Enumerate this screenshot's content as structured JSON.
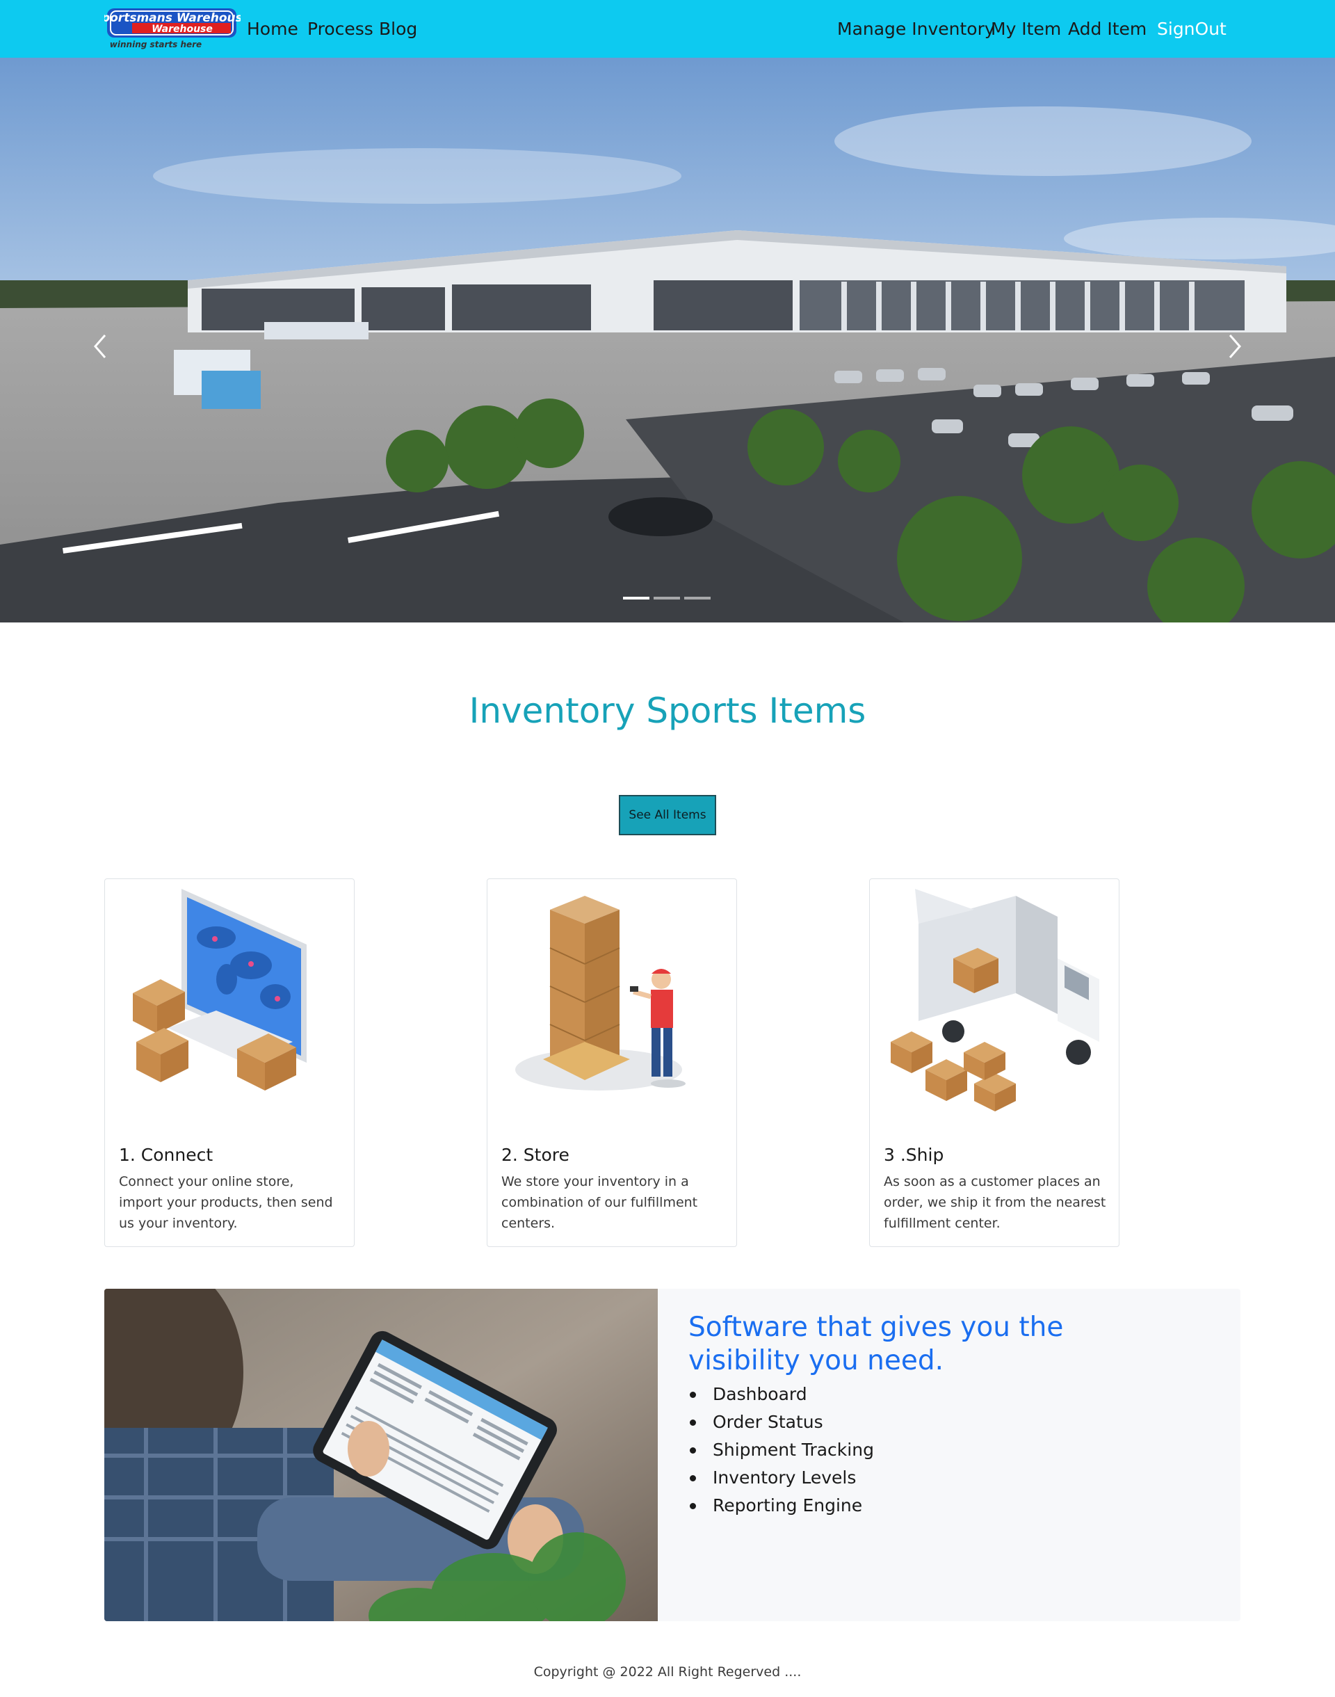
{
  "nav": {
    "logo_text": "Sportsmans Warehouse",
    "logo_tagline": "winning starts here",
    "left_links": [
      "Home",
      "Process",
      "Blog"
    ],
    "right_links": [
      "Manage Inventory",
      "My Item",
      "Add Item"
    ],
    "signout": "SignOut"
  },
  "colors": {
    "navbar": "#0dcaf0",
    "section_title": "#17a2b8",
    "button": "#17a2b8",
    "software_heading": "#1a6ef0"
  },
  "carousel": {
    "image": "warehouse-aerial-render",
    "prev_icon": "chevron-left-icon",
    "next_icon": "chevron-right-icon",
    "slide_count": 3,
    "active_slide": 1
  },
  "main": {
    "title": "Inventory Sports Items",
    "see_all_button": "See All Items"
  },
  "cards": [
    {
      "title": "1. Connect",
      "text": "Connect your online store, import your products, then send us your inventory.",
      "image": "computer-world-map-boxes"
    },
    {
      "title": "2. Store",
      "text": "We store your inventory in a combination of our fulfillment centers.",
      "image": "worker-scanning-pallet"
    },
    {
      "title": "3 .Ship",
      "text": "As soon as a customer places an order, we ship it from the nearest fulfillment center.",
      "image": "delivery-truck-boxes"
    }
  ],
  "software": {
    "heading": "Software that gives you the visibility you need.",
    "image": "person-holding-tablet",
    "features": [
      "Dashboard",
      "Order Status",
      "Shipment Tracking",
      "Inventory Levels",
      "Reporting Engine"
    ]
  },
  "footer": {
    "copyright": "Copyright @ 2022 All Right Regerved ...."
  }
}
